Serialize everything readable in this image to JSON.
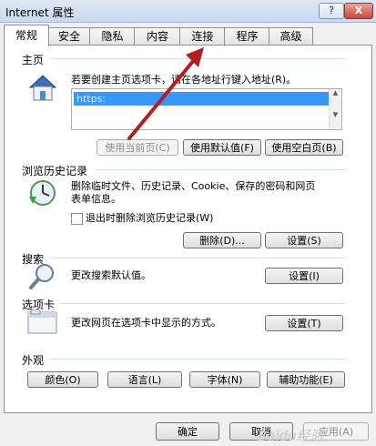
{
  "window": {
    "title": "Internet 属性",
    "help_label": "?",
    "close_label": "X"
  },
  "tabs": [
    {
      "label": "常规"
    },
    {
      "label": "安全"
    },
    {
      "label": "隐私"
    },
    {
      "label": "内容"
    },
    {
      "label": "连接"
    },
    {
      "label": "程序"
    },
    {
      "label": "高级"
    }
  ],
  "homepage": {
    "section": "主页",
    "description": "若要创建主页选项卡，请在各地址行键入地址(R)。",
    "address": "https:",
    "buttons": {
      "current": "使用当前页(C)",
      "default": "使用默认值(F)",
      "blank": "使用空白页(B)"
    }
  },
  "history": {
    "section": "浏览历史记录",
    "description_line1": "删除临时文件、历史记录、Cookie、保存的密码和网页",
    "description_line2": "表单信息。",
    "checkbox_label": "退出时删除浏览历史记录(W)",
    "buttons": {
      "delete": "删除(D)...",
      "settings": "设置(S)"
    }
  },
  "search": {
    "section": "搜索",
    "description": "更改搜索默认值。",
    "settings": "设置(I)"
  },
  "tabs_section": {
    "section": "选项卡",
    "description": "更改网页在选项卡中显示的方式。",
    "settings": "设置(T)"
  },
  "appearance": {
    "section": "外观",
    "buttons": {
      "colors": "颜色(O)",
      "languages": "语言(L)",
      "fonts": "字体(N)",
      "accessibility": "辅助功能(E)"
    }
  },
  "footer": {
    "ok": "确定",
    "cancel": "取消",
    "apply": "应用(A)"
  },
  "watermark": "Baidu经验",
  "colors": {
    "accent_arrow": "#b21f1f",
    "selection": "#3399ff"
  }
}
